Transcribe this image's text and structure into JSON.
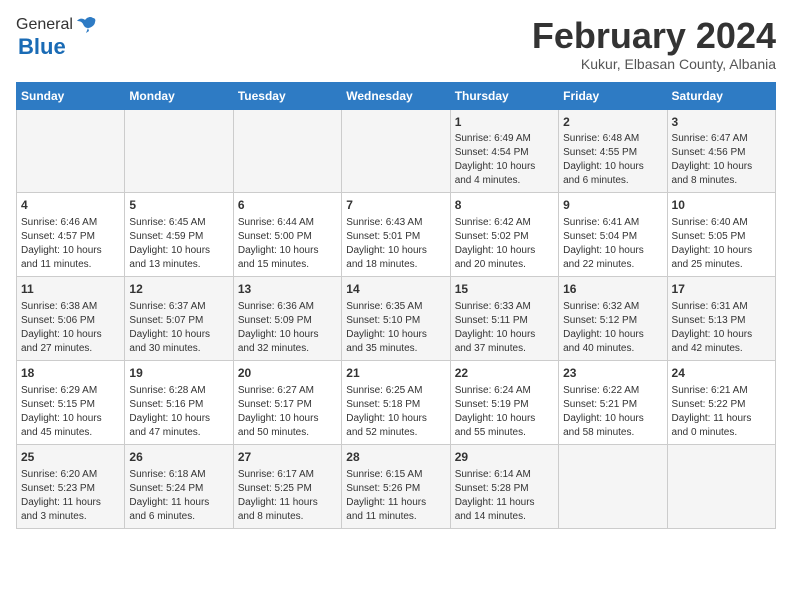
{
  "header": {
    "logo_general": "General",
    "logo_blue": "Blue",
    "month_title": "February 2024",
    "subtitle": "Kukur, Elbasan County, Albania"
  },
  "days_of_week": [
    "Sunday",
    "Monday",
    "Tuesday",
    "Wednesday",
    "Thursday",
    "Friday",
    "Saturday"
  ],
  "weeks": [
    [
      {
        "day": "",
        "info": ""
      },
      {
        "day": "",
        "info": ""
      },
      {
        "day": "",
        "info": ""
      },
      {
        "day": "",
        "info": ""
      },
      {
        "day": "1",
        "info": "Sunrise: 6:49 AM\nSunset: 4:54 PM\nDaylight: 10 hours\nand 4 minutes."
      },
      {
        "day": "2",
        "info": "Sunrise: 6:48 AM\nSunset: 4:55 PM\nDaylight: 10 hours\nand 6 minutes."
      },
      {
        "day": "3",
        "info": "Sunrise: 6:47 AM\nSunset: 4:56 PM\nDaylight: 10 hours\nand 8 minutes."
      }
    ],
    [
      {
        "day": "4",
        "info": "Sunrise: 6:46 AM\nSunset: 4:57 PM\nDaylight: 10 hours\nand 11 minutes."
      },
      {
        "day": "5",
        "info": "Sunrise: 6:45 AM\nSunset: 4:59 PM\nDaylight: 10 hours\nand 13 minutes."
      },
      {
        "day": "6",
        "info": "Sunrise: 6:44 AM\nSunset: 5:00 PM\nDaylight: 10 hours\nand 15 minutes."
      },
      {
        "day": "7",
        "info": "Sunrise: 6:43 AM\nSunset: 5:01 PM\nDaylight: 10 hours\nand 18 minutes."
      },
      {
        "day": "8",
        "info": "Sunrise: 6:42 AM\nSunset: 5:02 PM\nDaylight: 10 hours\nand 20 minutes."
      },
      {
        "day": "9",
        "info": "Sunrise: 6:41 AM\nSunset: 5:04 PM\nDaylight: 10 hours\nand 22 minutes."
      },
      {
        "day": "10",
        "info": "Sunrise: 6:40 AM\nSunset: 5:05 PM\nDaylight: 10 hours\nand 25 minutes."
      }
    ],
    [
      {
        "day": "11",
        "info": "Sunrise: 6:38 AM\nSunset: 5:06 PM\nDaylight: 10 hours\nand 27 minutes."
      },
      {
        "day": "12",
        "info": "Sunrise: 6:37 AM\nSunset: 5:07 PM\nDaylight: 10 hours\nand 30 minutes."
      },
      {
        "day": "13",
        "info": "Sunrise: 6:36 AM\nSunset: 5:09 PM\nDaylight: 10 hours\nand 32 minutes."
      },
      {
        "day": "14",
        "info": "Sunrise: 6:35 AM\nSunset: 5:10 PM\nDaylight: 10 hours\nand 35 minutes."
      },
      {
        "day": "15",
        "info": "Sunrise: 6:33 AM\nSunset: 5:11 PM\nDaylight: 10 hours\nand 37 minutes."
      },
      {
        "day": "16",
        "info": "Sunrise: 6:32 AM\nSunset: 5:12 PM\nDaylight: 10 hours\nand 40 minutes."
      },
      {
        "day": "17",
        "info": "Sunrise: 6:31 AM\nSunset: 5:13 PM\nDaylight: 10 hours\nand 42 minutes."
      }
    ],
    [
      {
        "day": "18",
        "info": "Sunrise: 6:29 AM\nSunset: 5:15 PM\nDaylight: 10 hours\nand 45 minutes."
      },
      {
        "day": "19",
        "info": "Sunrise: 6:28 AM\nSunset: 5:16 PM\nDaylight: 10 hours\nand 47 minutes."
      },
      {
        "day": "20",
        "info": "Sunrise: 6:27 AM\nSunset: 5:17 PM\nDaylight: 10 hours\nand 50 minutes."
      },
      {
        "day": "21",
        "info": "Sunrise: 6:25 AM\nSunset: 5:18 PM\nDaylight: 10 hours\nand 52 minutes."
      },
      {
        "day": "22",
        "info": "Sunrise: 6:24 AM\nSunset: 5:19 PM\nDaylight: 10 hours\nand 55 minutes."
      },
      {
        "day": "23",
        "info": "Sunrise: 6:22 AM\nSunset: 5:21 PM\nDaylight: 10 hours\nand 58 minutes."
      },
      {
        "day": "24",
        "info": "Sunrise: 6:21 AM\nSunset: 5:22 PM\nDaylight: 11 hours\nand 0 minutes."
      }
    ],
    [
      {
        "day": "25",
        "info": "Sunrise: 6:20 AM\nSunset: 5:23 PM\nDaylight: 11 hours\nand 3 minutes."
      },
      {
        "day": "26",
        "info": "Sunrise: 6:18 AM\nSunset: 5:24 PM\nDaylight: 11 hours\nand 6 minutes."
      },
      {
        "day": "27",
        "info": "Sunrise: 6:17 AM\nSunset: 5:25 PM\nDaylight: 11 hours\nand 8 minutes."
      },
      {
        "day": "28",
        "info": "Sunrise: 6:15 AM\nSunset: 5:26 PM\nDaylight: 11 hours\nand 11 minutes."
      },
      {
        "day": "29",
        "info": "Sunrise: 6:14 AM\nSunset: 5:28 PM\nDaylight: 11 hours\nand 14 minutes."
      },
      {
        "day": "",
        "info": ""
      },
      {
        "day": "",
        "info": ""
      }
    ]
  ]
}
